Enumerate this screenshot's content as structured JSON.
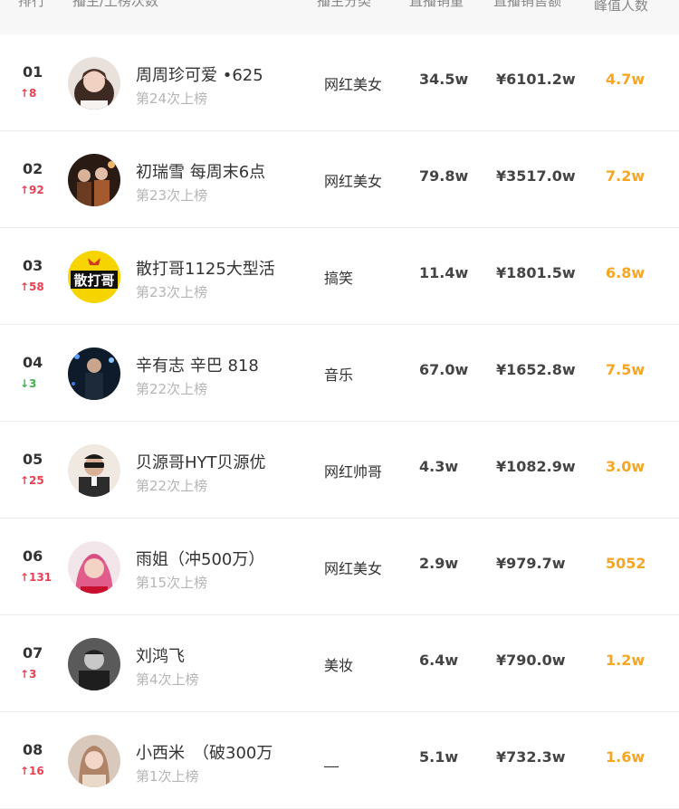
{
  "header": {
    "rank": "排行",
    "anchor": "播主/上榜次数",
    "category": "播主分类",
    "sales": "直播销量",
    "amount": "直播销售额",
    "peak": "峰值人数"
  },
  "rows": [
    {
      "rank": "01",
      "delta": "↑8",
      "trend": "up",
      "name": "周周珍可爱 •625",
      "times": "第24次上榜",
      "category": "网红美女",
      "sales": "34.5w",
      "amount": "¥6101.2w",
      "peak": "4.7w",
      "avatar": "woman-avatar-icon"
    },
    {
      "rank": "02",
      "delta": "↑92",
      "trend": "up",
      "name": "初瑞雪 每周末6点",
      "times": "第23次上榜",
      "category": "网红美女",
      "sales": "79.8w",
      "amount": "¥3517.0w",
      "peak": "7.2w",
      "avatar": "group-photo-avatar-icon"
    },
    {
      "rank": "03",
      "delta": "↑58",
      "trend": "up",
      "name": "散打哥1125大型活",
      "times": "第23次上榜",
      "category": "搞笑",
      "sales": "11.4w",
      "amount": "¥1801.5w",
      "peak": "6.8w",
      "avatar": "sandage-logo-avatar",
      "logo_text": "散打哥"
    },
    {
      "rank": "04",
      "delta": "↓3",
      "trend": "down",
      "name": "辛有志 辛巴 818",
      "times": "第22次上榜",
      "category": "音乐",
      "sales": "67.0w",
      "amount": "¥1652.8w",
      "peak": "7.5w",
      "avatar": "stage-performer-avatar-icon"
    },
    {
      "rank": "05",
      "delta": "↑25",
      "trend": "up",
      "name": "贝源哥HYT贝源优",
      "times": "第22次上榜",
      "category": "网红帅哥",
      "sales": "4.3w",
      "amount": "¥1082.9w",
      "peak": "3.0w",
      "avatar": "man-sunglasses-avatar-icon"
    },
    {
      "rank": "06",
      "delta": "↑131",
      "trend": "up",
      "name": "雨姐（冲500万）",
      "times": "第15次上榜",
      "category": "网红美女",
      "sales": "2.9w",
      "amount": "¥979.7w",
      "peak": "5052",
      "avatar": "woman-pink-avatar-icon"
    },
    {
      "rank": "07",
      "delta": "↑3",
      "trend": "up",
      "name": "刘鸿飞",
      "times": "第4次上榜",
      "category": "美妆",
      "sales": "6.4w",
      "amount": "¥790.0w",
      "peak": "1.2w",
      "avatar": "man-portrait-avatar-icon"
    },
    {
      "rank": "08",
      "delta": "↑16",
      "trend": "up",
      "name": "小西米　（破300万",
      "times": "第1次上榜",
      "category": "__",
      "sales": "5.1w",
      "amount": "¥732.3w",
      "peak": "1.6w",
      "avatar": "woman-selfie-avatar-icon"
    }
  ],
  "colors": {
    "up": "#e94153",
    "down": "#3cb44a",
    "peak": "#f5a623",
    "logo_bg": "#f5d400"
  }
}
